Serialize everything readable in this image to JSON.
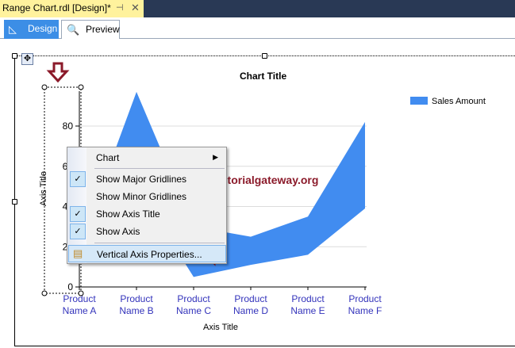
{
  "document_tab": {
    "title": "Range Chart.rdl [Design]*",
    "pin_icon": "pin-icon",
    "close_icon": "close-icon"
  },
  "view_tabs": [
    {
      "label": "Design",
      "icon": "design-icon",
      "active": true
    },
    {
      "label": "Preview",
      "icon": "preview-icon",
      "active": false
    }
  ],
  "watermark": "©tutorialgateway.org",
  "context_menu": {
    "items": [
      {
        "label": "Chart",
        "checked": false,
        "submenu": true
      },
      {
        "label": "Show Major Gridlines",
        "checked": true
      },
      {
        "label": "Show Minor Gridlines",
        "checked": false
      },
      {
        "label": "Show Axis Title",
        "checked": true
      },
      {
        "label": "Show Axis",
        "checked": true
      },
      {
        "label": "Vertical Axis Properties...",
        "highlighted": true,
        "icon": "axis-properties-icon"
      }
    ]
  },
  "chart_data": {
    "type": "area",
    "subtype": "range",
    "title": "Chart Title",
    "xlabel": "Axis Title",
    "ylabel": "Axis Title",
    "categories": [
      "Product Name A",
      "Product Name B",
      "Product Name C",
      "Product Name D",
      "Product Name E",
      "Product Name F"
    ],
    "category_lines": [
      [
        "Product",
        "Name A"
      ],
      [
        "Product",
        "Name B"
      ],
      [
        "Product",
        "Name C"
      ],
      [
        "Product",
        "Name D"
      ],
      [
        "Product",
        "Name E"
      ],
      [
        "Product",
        "Name F"
      ]
    ],
    "yticks": [
      0,
      20,
      40,
      60,
      80
    ],
    "ylim": [
      0,
      100
    ],
    "grid": true,
    "legend": "top-right",
    "series": [
      {
        "name": "Sales Amount",
        "high": [
          20,
          97,
          30,
          25,
          35,
          82
        ],
        "low": [
          11,
          50,
          5,
          11,
          16,
          39
        ],
        "color": "#418cf0"
      }
    ]
  }
}
